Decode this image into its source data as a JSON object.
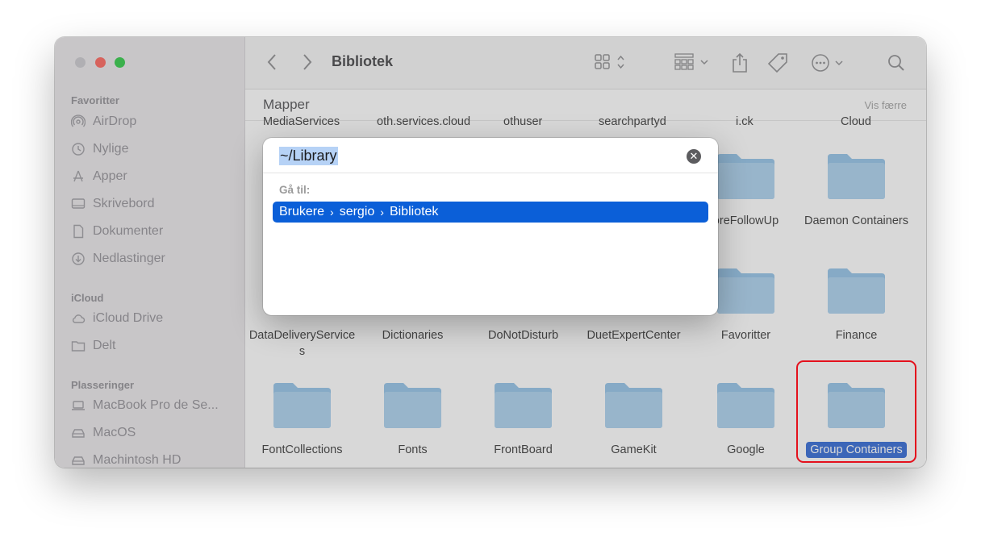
{
  "window": {
    "title": "Bibliotek"
  },
  "sidebar": {
    "favorites_title": "Favoritter",
    "favorites": [
      {
        "label": "AirDrop",
        "icon": "airdrop-icon"
      },
      {
        "label": "Nylige",
        "icon": "clock-icon"
      },
      {
        "label": "Apper",
        "icon": "apps-icon"
      },
      {
        "label": "Skrivebord",
        "icon": "desktop-icon"
      },
      {
        "label": "Dokumenter",
        "icon": "document-icon"
      },
      {
        "label": "Nedlastinger",
        "icon": "download-icon"
      }
    ],
    "icloud_title": "iCloud",
    "icloud": [
      {
        "label": "iCloud Drive",
        "icon": "cloud-icon"
      },
      {
        "label": "Delt",
        "icon": "shared-folder-icon"
      }
    ],
    "locations_title": "Plasseringer",
    "locations": [
      {
        "label": "MacBook Pro de Se...",
        "icon": "laptop-icon"
      },
      {
        "label": "MacOS",
        "icon": "drive-icon"
      },
      {
        "label": "Machintosh HD",
        "icon": "drive-icon"
      }
    ]
  },
  "content": {
    "section_title": "Mapper",
    "section_toggle": "Vis færre",
    "top_row_cut": [
      "MediaServices",
      "oth.services.cloud",
      "othuser",
      "searchpartyd",
      "i.ck",
      "Cloud"
    ],
    "row1": [
      {
        "label": "DataDeliveryServices"
      },
      {
        "label": "Dictionaries"
      },
      {
        "label": "DoNotDisturb"
      },
      {
        "label": "DuetExpertCenter"
      },
      {
        "label": "Favoritter"
      },
      {
        "label": "Finance"
      }
    ],
    "row2": [
      {
        "label": "FontCollections"
      },
      {
        "label": "Fonts"
      },
      {
        "label": "FrontBoard"
      },
      {
        "label": "GameKit"
      },
      {
        "label": "Google"
      },
      {
        "label": "Group Containers",
        "selected": true
      }
    ],
    "partial_right": [
      {
        "label": "oreFollowUp"
      },
      {
        "label": "Daemon Containers"
      }
    ]
  },
  "dialog": {
    "input_value": "~/Library",
    "goto_label": "Gå til:",
    "suggestion": [
      "Brukere",
      "sergio",
      "Bibliotek"
    ]
  },
  "colors": {
    "folder_body": "#a8d0ee",
    "folder_tab": "#8fc0e6",
    "selection": "#0b5fd8",
    "highlight_box": "#e4111d"
  }
}
